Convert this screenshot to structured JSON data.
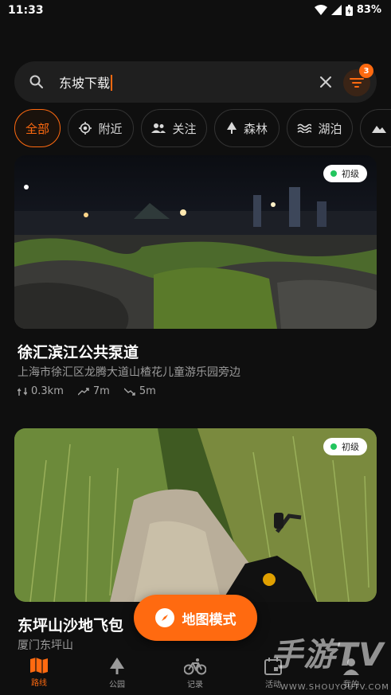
{
  "status_bar": {
    "time": "11:33",
    "battery": "83%"
  },
  "search": {
    "query": "东坡下载",
    "filter_count": "3"
  },
  "chips": [
    {
      "label": "全部",
      "icon": "none"
    },
    {
      "label": "附近",
      "icon": "locate-icon"
    },
    {
      "label": "关注",
      "icon": "people-icon"
    },
    {
      "label": "森林",
      "icon": "tree-icon"
    },
    {
      "label": "湖泊",
      "icon": "water-icon"
    }
  ],
  "routes": [
    {
      "title": "徐汇滨江公共泵道",
      "address": "上海市徐汇区龙腾大道山楂花儿童游乐园旁边",
      "level": "初级",
      "distance": "0.3km",
      "ascent": "7m",
      "descent": "5m"
    },
    {
      "title": "东坪山沙地飞包",
      "address": "厦门东坪山",
      "level": "初级"
    }
  ],
  "map_mode_label": "地图模式",
  "nav": [
    {
      "label": "路线",
      "icon": "map-icon"
    },
    {
      "label": "公园",
      "icon": "tree-icon"
    },
    {
      "label": "记录",
      "icon": "bike-icon"
    },
    {
      "label": "活动",
      "icon": "calendar-icon"
    },
    {
      "label": "我的",
      "icon": "person-icon"
    }
  ],
  "watermark": {
    "brand": "手游TV",
    "url": "WWW.SHOUYOUTV.COM"
  },
  "colors": {
    "accent": "#ff6a10",
    "background": "#0f0f0f",
    "level_green": "#22c55e"
  }
}
